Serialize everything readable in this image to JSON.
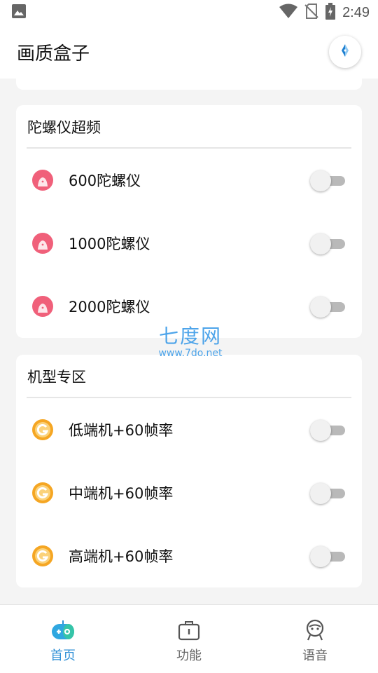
{
  "status_bar": {
    "time": "2:49",
    "icons": [
      "image-icon",
      "wifi-icon",
      "no-sim-icon",
      "battery-charging-icon"
    ]
  },
  "app_bar": {
    "title": "画质盒子",
    "action_icon": "compass-icon"
  },
  "sections": [
    {
      "title": "陀螺仪超频",
      "items": [
        {
          "label": "600陀螺仪",
          "icon": "gyro-app-icon",
          "on": false
        },
        {
          "label": "1000陀螺仪",
          "icon": "gyro-app-icon",
          "on": false
        },
        {
          "label": "2000陀螺仪",
          "icon": "gyro-app-icon",
          "on": false
        }
      ]
    },
    {
      "title": "机型专区",
      "items": [
        {
          "label": "低端机+60帧率",
          "icon": "g-badge-icon",
          "on": false
        },
        {
          "label": "中端机+60帧率",
          "icon": "g-badge-icon",
          "on": false
        },
        {
          "label": "高端机+60帧率",
          "icon": "g-badge-icon",
          "on": false
        }
      ]
    }
  ],
  "watermark": {
    "brand": "七度网",
    "url": "www.7do.net"
  },
  "bottom_nav": {
    "items": [
      {
        "label": "首页",
        "icon": "gamepad-icon",
        "active": true
      },
      {
        "label": "功能",
        "icon": "toolbox-icon",
        "active": false
      },
      {
        "label": "语音",
        "icon": "robot-face-icon",
        "active": false
      }
    ]
  },
  "colors": {
    "accent": "#2e8fd6",
    "toggle_track_off": "#b9b9b9",
    "gyro_icon": "#f0607a",
    "g_badge": "#f5a623"
  }
}
